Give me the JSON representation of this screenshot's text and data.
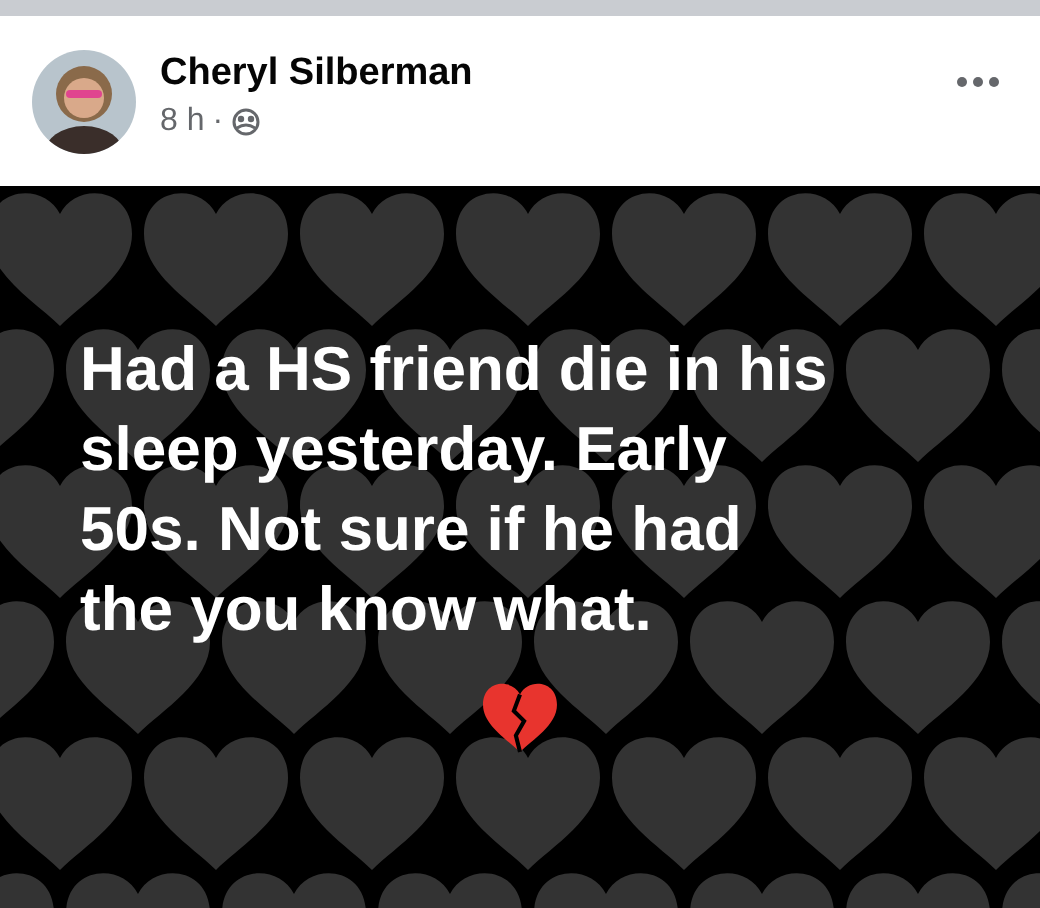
{
  "post": {
    "author": "Cheryl Silberman",
    "time": "8 h",
    "separator": "·",
    "text": "Had a HS friend die in his\nsleep yesterday. Early\n50s. Not sure if he had\nthe you know what."
  }
}
